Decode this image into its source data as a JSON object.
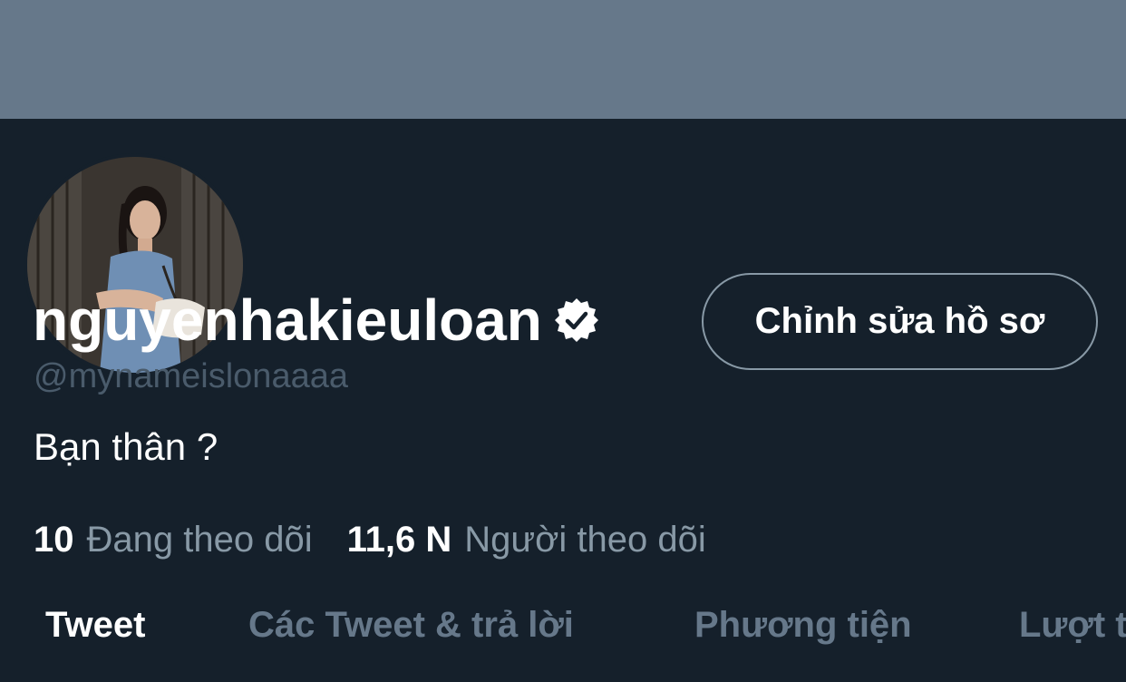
{
  "profile": {
    "edit_button_label": "Chỉnh sửa hồ sơ",
    "display_name": "nguyenhakieuloan",
    "verified_icon": "verified-badge-icon",
    "handle": "@mynameislonaaaa",
    "bio": "Bạn thân ?"
  },
  "stats": {
    "following_count": "10",
    "following_label": "Đang theo dõi",
    "followers_count": "11,6 N",
    "followers_label": "Người theo dõi"
  },
  "tabs": [
    {
      "label": "Tweet",
      "active": true
    },
    {
      "label": "Các Tweet & trả lời",
      "active": false
    },
    {
      "label": "Phương tiện",
      "active": false
    },
    {
      "label": "Lượt thích",
      "active": false
    }
  ],
  "colors": {
    "background": "#15202b",
    "banner": "#66788a",
    "text_primary": "#ffffff",
    "text_secondary": "#8899a6"
  }
}
